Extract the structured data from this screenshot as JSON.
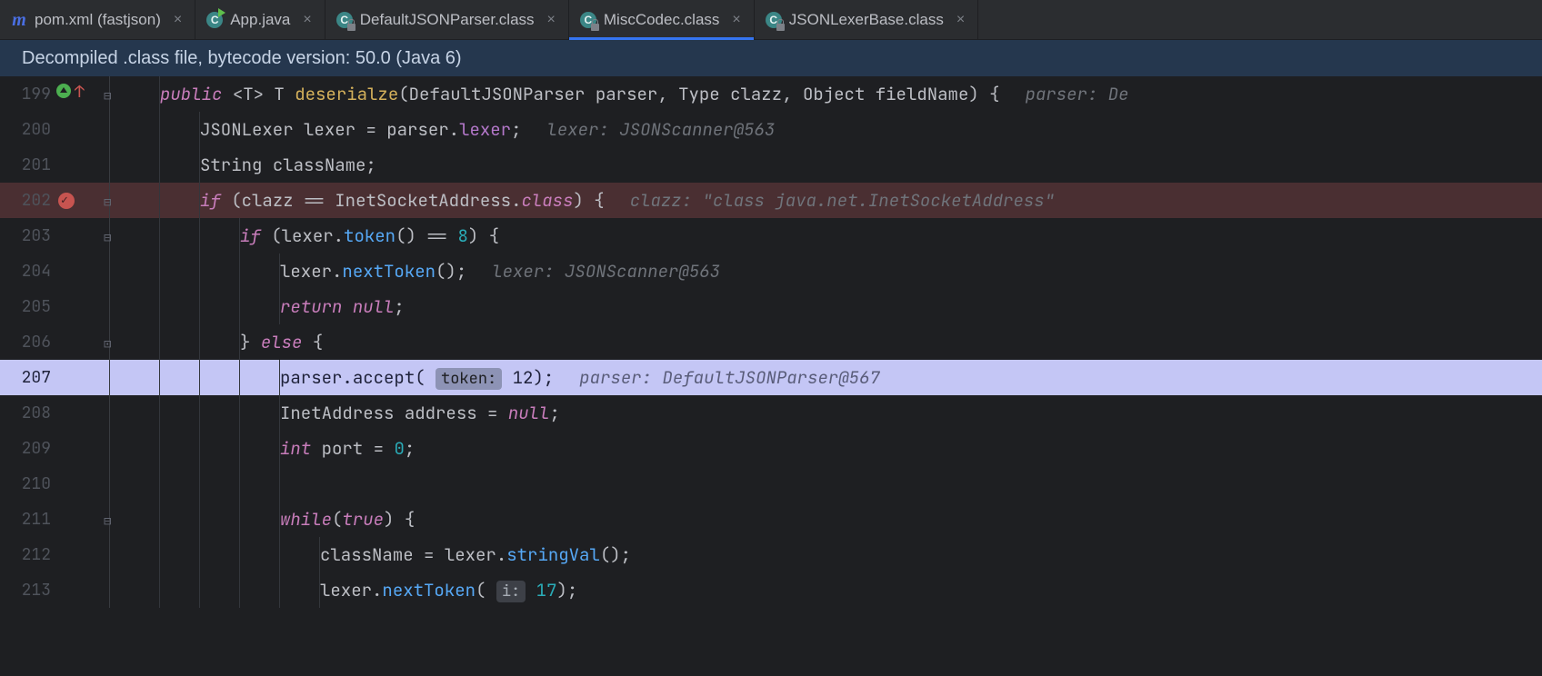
{
  "tabs": [
    {
      "label": "pom.xml (fastjson)",
      "icon": "maven",
      "active": false
    },
    {
      "label": "App.java",
      "icon": "class-run",
      "active": false
    },
    {
      "label": "DefaultJSONParser.class",
      "icon": "class-lock",
      "active": false
    },
    {
      "label": "MiscCodec.class",
      "icon": "class-lock",
      "active": true
    },
    {
      "label": "JSONLexerBase.class",
      "icon": "class-lock",
      "active": false
    }
  ],
  "banner": "Decompiled .class file, bytecode version: 50.0 (Java 6)",
  "lines": {
    "l199": {
      "num": "199",
      "sig": {
        "kw": "public",
        "gen": "<T> T",
        "name": "deserialze",
        "p1t": "DefaultJSONParser",
        "p1n": "parser",
        "p2t": "Type",
        "p2n": "clazz",
        "p3t": "Object",
        "p3n": "fieldName"
      },
      "hint": "parser: De"
    },
    "l200": {
      "num": "200",
      "type": "JSONLexer",
      "var": "lexer",
      "rhs1": "parser",
      "rhs2": "lexer",
      "hint": "lexer: JSONScanner@563"
    },
    "l201": {
      "num": "201",
      "type": "String",
      "var": "className"
    },
    "l202": {
      "num": "202",
      "kw": "if",
      "lhs": "clazz",
      "op": "==",
      "rhs1": "InetSocketAddress",
      "rhs2": "class",
      "hint": "clazz: \"class java.net.InetSocketAddress\""
    },
    "l203": {
      "num": "203",
      "kw": "if",
      "obj": "lexer",
      "call": "token",
      "op": "==",
      "val": "8"
    },
    "l204": {
      "num": "204",
      "obj": "lexer",
      "call": "nextToken",
      "hint": "lexer: JSONScanner@563"
    },
    "l205": {
      "num": "205",
      "kw": "return",
      "val": "null"
    },
    "l206": {
      "num": "206",
      "close": "}",
      "kw": "else",
      "open": "{"
    },
    "l207": {
      "num": "207",
      "obj": "parser",
      "call": "accept",
      "chip": "token:",
      "arg": "12",
      "hint": "parser: DefaultJSONParser@567"
    },
    "l208": {
      "num": "208",
      "type": "InetAddress",
      "var": "address",
      "val": "null"
    },
    "l209": {
      "num": "209",
      "type": "int",
      "var": "port",
      "val": "0"
    },
    "l210": {
      "num": "210"
    },
    "l211": {
      "num": "211",
      "kw": "while",
      "cond": "true"
    },
    "l212": {
      "num": "212",
      "lhs": "className",
      "obj": "lexer",
      "call": "stringVal"
    },
    "l213": {
      "num": "213",
      "obj": "lexer",
      "call": "nextToken",
      "chip": "i:",
      "arg": "17"
    }
  }
}
